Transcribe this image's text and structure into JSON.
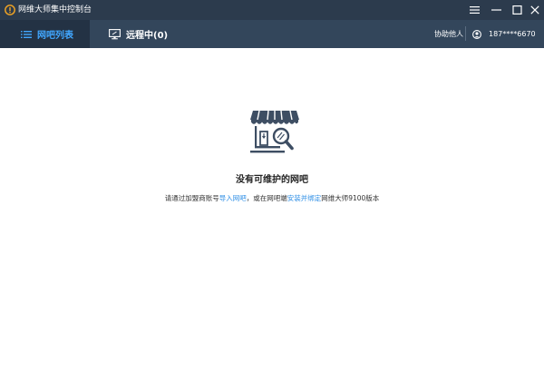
{
  "window": {
    "title": "网维大师集中控制台"
  },
  "tabs": [
    {
      "label": "网吧列表",
      "active": true,
      "icon": "list-icon"
    },
    {
      "label": "远程中(0)",
      "active": false,
      "icon": "monitor-icon"
    }
  ],
  "header": {
    "assist_label": "协助他人",
    "user_name": "187****6670"
  },
  "empty_state": {
    "title": "没有可维护的网吧",
    "hint_part1": "请通过加盟商账号",
    "hint_link1": "导入网吧",
    "hint_part2": "，或在网吧端",
    "hint_link2": "安装并绑定",
    "hint_part3": "网维大师9100版本"
  },
  "colors": {
    "titlebar": "#2c3b4d",
    "tabbar": "#33465b",
    "tab_active_bg": "#233244",
    "accent": "#41a7ff",
    "link": "#2f8fe6",
    "illustration": "#3e4e63"
  },
  "icons": {
    "app": "app-logo-icon",
    "menu": "menu-icon",
    "minimize": "minimize-icon",
    "maximize": "maximize-icon",
    "close": "close-icon",
    "user": "user-icon",
    "dropdown": "dropdown-arrow-icon",
    "illustration": "shop-search-illustration"
  }
}
